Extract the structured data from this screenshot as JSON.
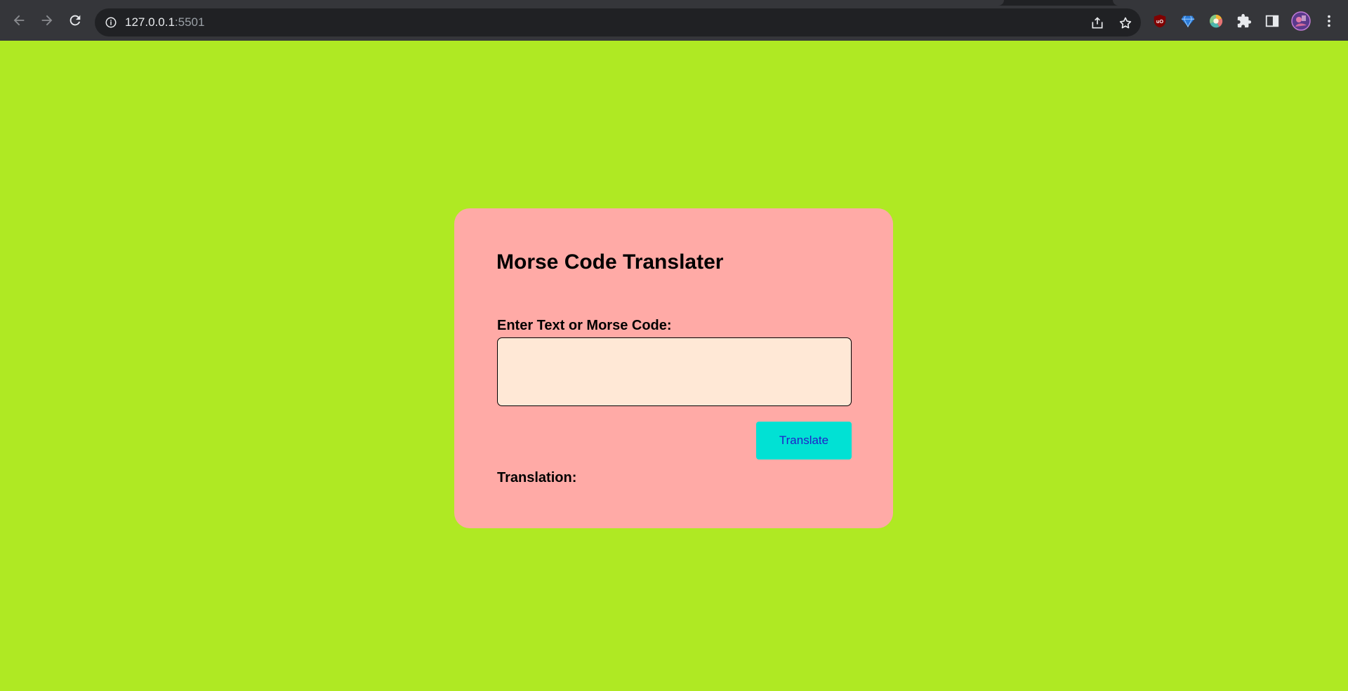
{
  "browser": {
    "url_host": "127.0.0.1",
    "url_port": ":5501"
  },
  "page": {
    "title": "Morse Code Translater",
    "input_label": "Enter Text or Morse Code:",
    "input_value": "",
    "translate_button": "Translate",
    "result_label": "Translation:"
  },
  "colors": {
    "background": "#afe923",
    "card": "#ffaaa6",
    "input_bg": "#ffe8d6",
    "button_bg": "#01e1d4",
    "button_text": "#1f1fc9"
  }
}
